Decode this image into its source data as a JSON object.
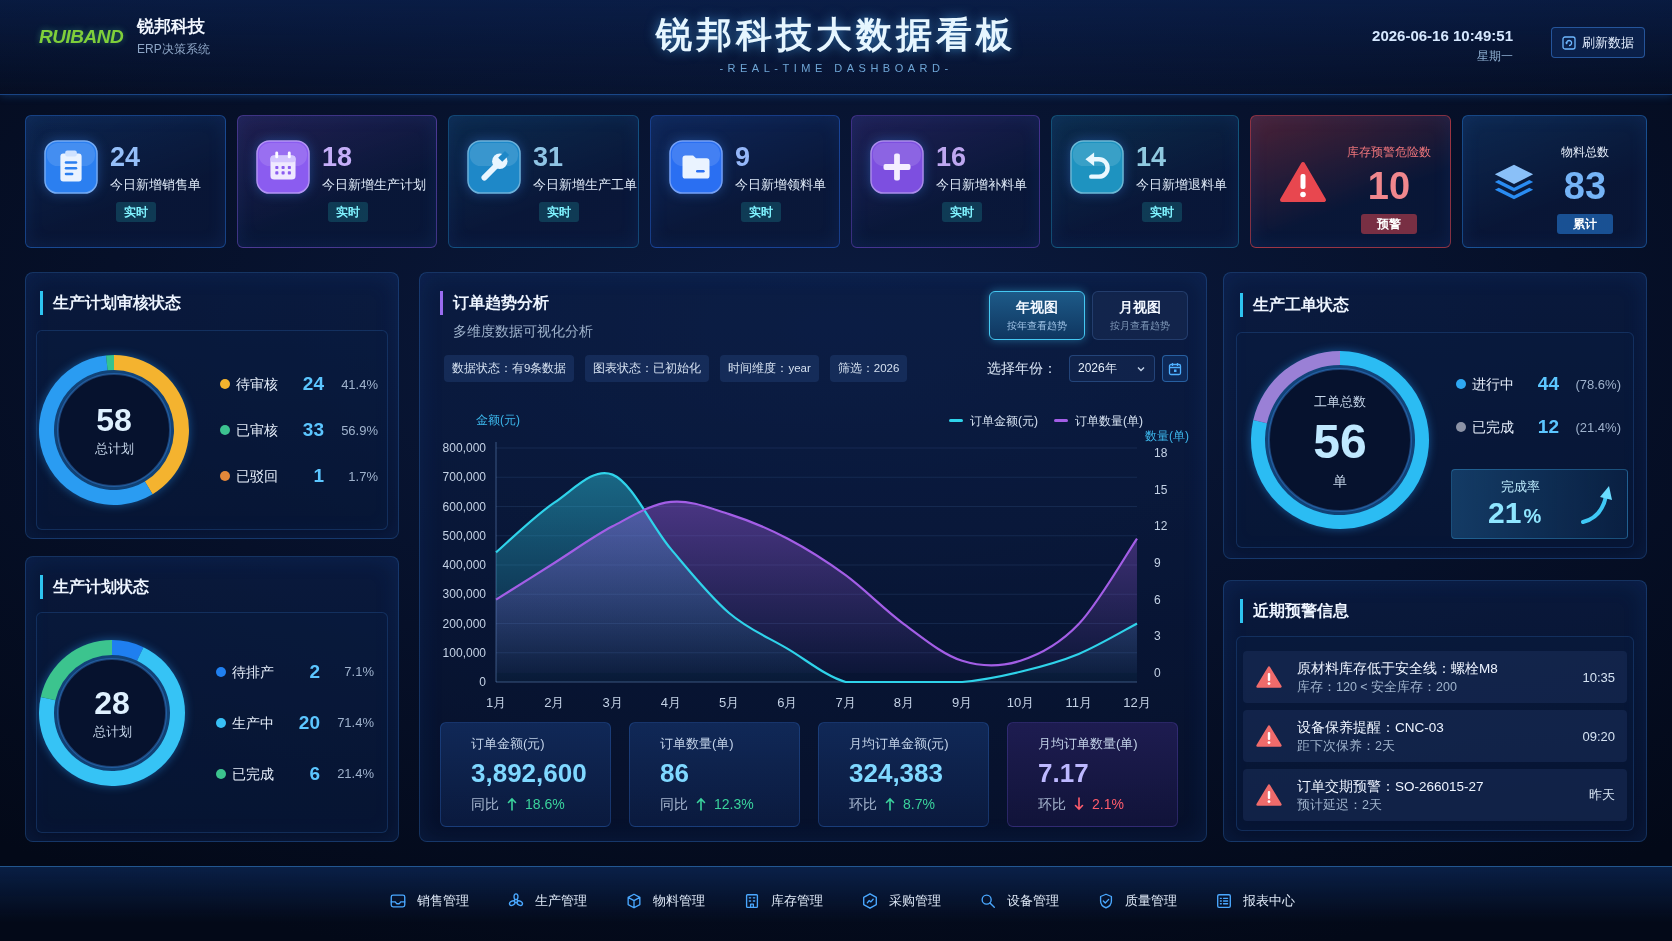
{
  "header": {
    "logo": "RUIBAND",
    "company": "锐邦科技",
    "system": "ERP决策系统",
    "title": "锐邦科技大数据看板",
    "subtitle": "-REAL-TIME DASHBOARD-",
    "datetime": "2026-06-16 10:49:51",
    "weekday": "星期一",
    "refresh_button": "刷新数据"
  },
  "stat_cards": [
    {
      "kind": "stat",
      "value": "24",
      "label": "今日新增销售单",
      "badge": "实时",
      "color": "#2b7ff0"
    },
    {
      "kind": "stat",
      "value": "18",
      "label": "今日新增生产计划",
      "badge": "实时",
      "color": "#8b5cf0"
    },
    {
      "kind": "stat",
      "value": "31",
      "label": "今日新增生产工单",
      "badge": "实时",
      "color": "#1e88c8"
    },
    {
      "kind": "stat",
      "value": "9",
      "label": "今日新增领料单",
      "badge": "实时",
      "color": "#2a6ff2"
    },
    {
      "kind": "stat",
      "value": "16",
      "label": "今日新增补料单",
      "badge": "实时",
      "color": "#7d4fe0"
    },
    {
      "kind": "stat",
      "value": "14",
      "label": "今日新增退料单",
      "badge": "实时",
      "color": "#1e93c0"
    },
    {
      "kind": "alert",
      "label": "库存预警危险数",
      "value": "10",
      "badge": "预警",
      "color": "#e8474f"
    },
    {
      "kind": "total",
      "label": "物料总数",
      "value": "83",
      "badge": "累计",
      "color": "#2a8cf2"
    }
  ],
  "plan_review": {
    "title": "生产计划审核状态",
    "center_value": "58",
    "center_label": "总计划",
    "legend": [
      {
        "value": "24",
        "percent": "41.4%",
        "color": "#f5b52e"
      },
      {
        "value": "33",
        "percent": "56.9%",
        "color": "#3cc290"
      },
      {
        "value": "1",
        "percent": "1.7%",
        "color": "#e2873a"
      }
    ],
    "chart_data": {
      "type": "donut",
      "categories": [
        "待审核",
        "已审核",
        "已驳回"
      ],
      "values": [
        41.4,
        56.9,
        1.7
      ]
    }
  },
  "plan_status": {
    "title": "生产计划状态",
    "center_value": "28",
    "center_label": "总计划",
    "legend": [
      {
        "value": "2",
        "percent": "7.1%",
        "color": "#2080f0"
      },
      {
        "value": "20",
        "percent": "71.4%",
        "color": "#38c0f5"
      },
      {
        "value": "6",
        "percent": "21.4%",
        "color": "#3cc48e"
      }
    ],
    "chart_data": {
      "type": "donut",
      "categories": [
        "待排产",
        "生产中",
        "已完成"
      ],
      "values": [
        7.1,
        71.4,
        21.5
      ]
    }
  },
  "order_trend": {
    "title": "订单趋势分析",
    "subtitle": "多维度数据可视化分析",
    "view_toggle": [
      {
        "label": "年视图",
        "hint": "按年查看趋势",
        "selected": true
      },
      {
        "label": "月视图",
        "hint": "按月查看趋势",
        "selected": false
      }
    ],
    "chips": [
      "数据状态：有9条数据",
      "图表状态：已初始化",
      "时间维度：year",
      "筛选：2026"
    ],
    "year_select": {
      "label": "选择年份：",
      "value": "2026年"
    },
    "chart_data": {
      "type": "area",
      "ylabel": "金额(元)",
      "y2label": "数量(单)",
      "categories": [
        "1月",
        "2月",
        "3月",
        "4月",
        "5月",
        "6月",
        "7月",
        "8月",
        "9月",
        "10月",
        "11月",
        "12月"
      ],
      "series": [
        {
          "name": "订单金额(元)",
          "color": "#2fd3ea",
          "values": [
            443000,
            613000,
            709000,
            455000,
            236000,
            114000,
            0,
            0,
            0,
            35000,
            96000,
            200000
          ]
        },
        {
          "name": "订单数量(单)",
          "color": "#a35ee6",
          "axis": "y2",
          "values": [
            6,
            9,
            12,
            14,
            13,
            11,
            8,
            4,
            1,
            1,
            4,
            11
          ]
        }
      ],
      "ylim": [
        0,
        800000
      ],
      "yticks": [
        0,
        {
          "value": 100000,
          "label": "100,000"
        },
        {
          "value": 200000,
          "label": "200,000"
        },
        {
          "value": 300000,
          "label": "300,000"
        },
        {
          "value": 400000,
          "label": "400,000"
        },
        {
          "value": 500000,
          "label": "500,000"
        },
        {
          "value": 600000,
          "label": "600,000"
        },
        {
          "value": 700000,
          "label": "700,000"
        },
        {
          "value": 800000,
          "label": "800,000"
        }
      ],
      "y2lim": [
        0,
        18
      ],
      "y2ticks": [
        0,
        3,
        6,
        9,
        12,
        15,
        18
      ],
      "grid": true,
      "legend": "top-right"
    },
    "summary": [
      {
        "label": "订单金额(元)",
        "value": "3,892,600",
        "compare_label": "同比",
        "change": "18.6%",
        "rising": true
      },
      {
        "label": "订单数量(单)",
        "value": "86",
        "compare_label": "同比",
        "change": "12.3%",
        "rising": true
      },
      {
        "label": "月均订单金额(元)",
        "value": "324,383",
        "compare_label": "环比",
        "change": "8.7%",
        "rising": true
      },
      {
        "label": "月均订单数量(单)",
        "value": "7.17",
        "compare_label": "环比",
        "change": "2.1%",
        "rising": false
      }
    ]
  },
  "work_orders": {
    "title": "生产工单状态",
    "center_label": "工单总数",
    "center_value": "56",
    "center_unit": "单",
    "legend": [
      {
        "value": "44",
        "percent": "(78.6%)",
        "color": "#2ea8f2"
      },
      {
        "value": "12",
        "percent": "(21.4%)",
        "color": "#8c93a6"
      }
    ],
    "chart_data": {
      "type": "donut",
      "categories": [
        "进行中",
        "已完成"
      ],
      "values": [
        78.6,
        21.4
      ]
    },
    "completion": {
      "label": "完成率",
      "value": "21",
      "unit": "%"
    }
  },
  "alerts": {
    "title": "近期预警信息",
    "items": [
      {
        "title": "原材料库存低于安全线：螺栓M8",
        "detail": "库存：120 < 安全库存：200",
        "time": "10:35"
      },
      {
        "title": "设备保养提醒：CNC-03",
        "detail": "距下次保养：2天",
        "time": "09:20"
      },
      {
        "title": "订单交期预警：SO-266015-27",
        "detail": "预计延迟：2天",
        "time": "昨天"
      }
    ]
  },
  "bottom_nav": [
    "销售管理",
    "生产管理",
    "物料管理",
    "库存管理",
    "采购管理",
    "设备管理",
    "质量管理",
    "报表中心"
  ]
}
